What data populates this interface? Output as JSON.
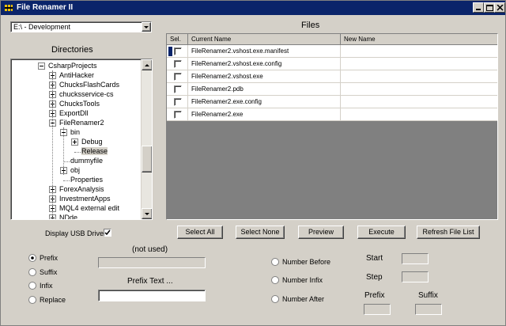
{
  "window": {
    "title": "File Renamer II",
    "accent_color": "#0a246a",
    "face_color": "#d4d0c8"
  },
  "drive_combo": {
    "value": "E:\\ - Development"
  },
  "directories": {
    "heading": "Directories",
    "items": [
      {
        "label": "CsharpProjects",
        "level": 0,
        "expander": "minus"
      },
      {
        "label": "AntiHacker",
        "level": 1,
        "expander": "plus"
      },
      {
        "label": "ChucksFlashCards",
        "level": 1,
        "expander": "plus"
      },
      {
        "label": "chucksservice-cs",
        "level": 1,
        "expander": "plus"
      },
      {
        "label": "ChucksTools",
        "level": 1,
        "expander": "plus"
      },
      {
        "label": "ExportDll",
        "level": 1,
        "expander": "plus"
      },
      {
        "label": "FileRenamer2",
        "level": 1,
        "expander": "minus"
      },
      {
        "label": "bin",
        "level": 2,
        "expander": "minus"
      },
      {
        "label": "Debug",
        "level": 3,
        "expander": "plus"
      },
      {
        "label": "Release",
        "level": 3,
        "expander": "none",
        "selected": true
      },
      {
        "label": "dummyfile",
        "level": 2,
        "expander": "none"
      },
      {
        "label": "obj",
        "level": 2,
        "expander": "plus"
      },
      {
        "label": "Properties",
        "level": 2,
        "expander": "none"
      },
      {
        "label": "ForexAnalysis",
        "level": 1,
        "expander": "plus"
      },
      {
        "label": "InvestmentApps",
        "level": 1,
        "expander": "plus"
      },
      {
        "label": "MQL4 external edit",
        "level": 1,
        "expander": "plus"
      },
      {
        "label": "NDde",
        "level": 1,
        "expander": "plus"
      }
    ]
  },
  "files": {
    "heading": "Files",
    "columns": [
      "Sel.",
      "Current Name",
      "New Name"
    ],
    "rows": [
      {
        "selected": false,
        "current": "FileRenamer2.vshost.exe.manifest",
        "new_name": ""
      },
      {
        "selected": false,
        "current": "FileRenamer2.vshost.exe.config",
        "new_name": ""
      },
      {
        "selected": false,
        "current": "FileRenamer2.vshost.exe",
        "new_name": ""
      },
      {
        "selected": false,
        "current": "FileRenamer2.pdb",
        "new_name": ""
      },
      {
        "selected": false,
        "current": "FileRenamer2.exe.config",
        "new_name": ""
      },
      {
        "selected": false,
        "current": "FileRenamer2.exe",
        "new_name": ""
      }
    ]
  },
  "usb": {
    "label": "Display USB Drives",
    "checked": true
  },
  "buttons": {
    "select_all": "Select All",
    "select_none": "Select None",
    "preview": "Preview",
    "execute": "Execute",
    "refresh": "Refresh File List"
  },
  "mode": {
    "options": [
      "Prefix",
      "Suffix",
      "Infix",
      "Replace"
    ],
    "selected": "Prefix"
  },
  "not_used": {
    "label": "(not used)",
    "value": ""
  },
  "prefix_text": {
    "label": "Prefix Text ...",
    "value": ""
  },
  "numbering": {
    "options": [
      "Number Before",
      "Number Infix",
      "Number After"
    ],
    "selected": ""
  },
  "start": {
    "label": "Start",
    "value": ""
  },
  "step": {
    "label": "Step",
    "value": ""
  },
  "prefix": {
    "label": "Prefix",
    "value": ""
  },
  "suffix": {
    "label": "Suffix",
    "value": ""
  }
}
